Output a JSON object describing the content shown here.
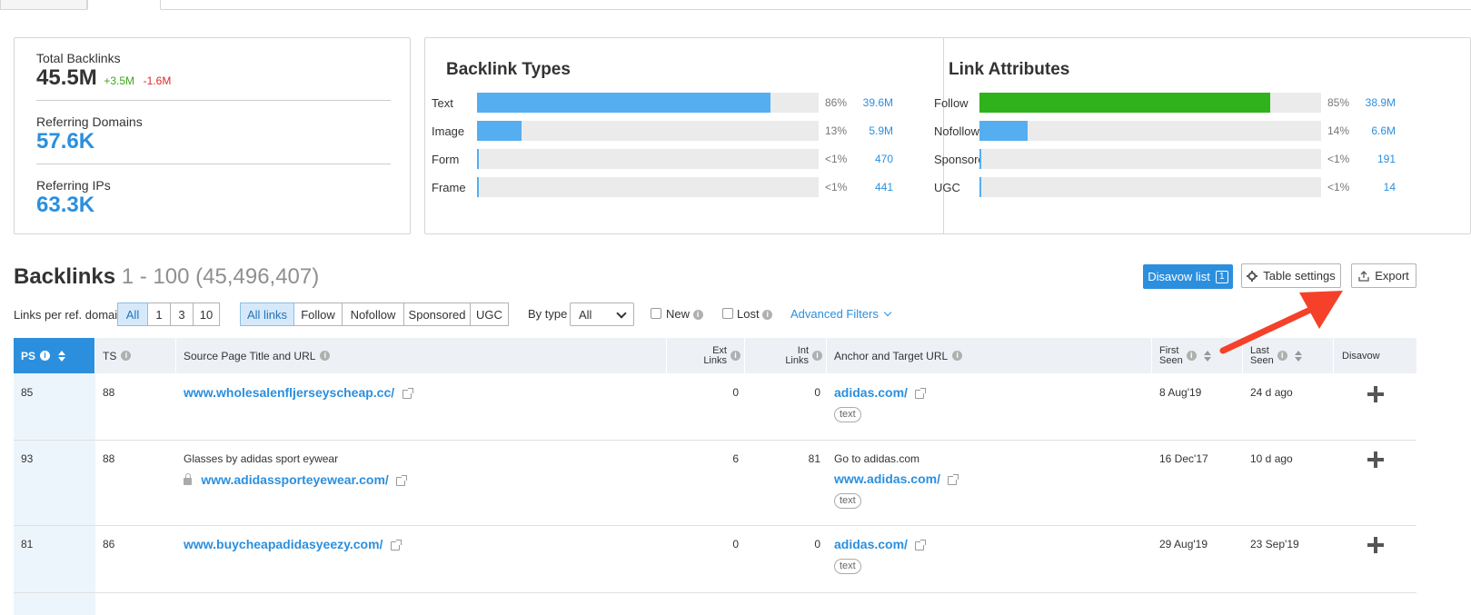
{
  "summary": {
    "total_backlinks_label": "Total Backlinks",
    "total_backlinks_value": "45.5M",
    "total_backlinks_up": "+3.5M",
    "total_backlinks_down": "-1.6M",
    "referring_domains_label": "Referring Domains",
    "referring_domains_value": "57.6K",
    "referring_ips_label": "Referring IPs",
    "referring_ips_value": "63.3K"
  },
  "backlink_types": {
    "title": "Backlink Types",
    "rows": [
      {
        "label": "Text",
        "pct": "86%",
        "count": "39.6M",
        "fill": 0.86,
        "color": "#55aef0"
      },
      {
        "label": "Image",
        "pct": "13%",
        "count": "5.9M",
        "fill": 0.13,
        "color": "#55aef0"
      },
      {
        "label": "Form",
        "pct": "<1%",
        "count": "470",
        "fill": 0.005,
        "color": "#55aef0"
      },
      {
        "label": "Frame",
        "pct": "<1%",
        "count": "441",
        "fill": 0.005,
        "color": "#55aef0"
      }
    ]
  },
  "link_attributes": {
    "title": "Link Attributes",
    "rows": [
      {
        "label": "Follow",
        "pct": "85%",
        "count": "38.9M",
        "fill": 0.85,
        "color": "#2fb21b"
      },
      {
        "label": "Nofollow",
        "pct": "14%",
        "count": "6.6M",
        "fill": 0.14,
        "color": "#55aef0"
      },
      {
        "label": "Sponsored",
        "pct": "<1%",
        "count": "191",
        "fill": 0.005,
        "color": "#55aef0"
      },
      {
        "label": "UGC",
        "pct": "<1%",
        "count": "14",
        "fill": 0.005,
        "color": "#55aef0"
      }
    ]
  },
  "backlinks": {
    "title": "Backlinks",
    "range": "1 - 100 (45,496,407)",
    "disavow_label": "Disavow list",
    "disavow_count": "1",
    "table_settings_label": "Table settings",
    "export_label": "Export"
  },
  "filters": {
    "links_per_domain_label": "Links per ref. domain",
    "links_per_domain_options": [
      "All",
      "1",
      "3",
      "10"
    ],
    "link_type_options": [
      "All links",
      "Follow",
      "Nofollow",
      "Sponsored",
      "UGC"
    ],
    "by_type_label": "By type",
    "by_type_value": "All",
    "new_label": "New",
    "lost_label": "Lost",
    "advanced_label": "Advanced Filters"
  },
  "table": {
    "headers": {
      "ps": "PS",
      "ts": "TS",
      "source": "Source Page Title and URL",
      "ext_1": "Ext",
      "ext_2": "Links",
      "int_1": "Int",
      "int_2": "Links",
      "anchor": "Anchor and Target URL",
      "first_1": "First",
      "first_2": "Seen",
      "last_1": "Last",
      "last_2": "Seen",
      "disavow": "Disavow"
    },
    "rows": [
      {
        "ps": "85",
        "ts": "88",
        "title": "",
        "url": "www.wholesalenfljerseyscheap.cc/",
        "ext": "0",
        "int": "0",
        "anchor_text": "",
        "target": "adidas.com/",
        "type": "text",
        "first": "8 Aug'19",
        "last": "24 d ago"
      },
      {
        "ps": "93",
        "ts": "88",
        "title": "Glasses by adidas sport eywear",
        "url": "www.adidassporteyewear.com/",
        "ext": "6",
        "int": "81",
        "anchor_text": "Go to adidas.com",
        "target": "www.adidas.com/",
        "type": "text",
        "first": "16 Dec'17",
        "last": "10 d ago"
      },
      {
        "ps": "81",
        "ts": "86",
        "title": "",
        "url": "www.buycheapadidasyeezy.com/",
        "ext": "0",
        "int": "0",
        "anchor_text": "",
        "target": "adidas.com/",
        "type": "text",
        "first": "29 Aug'19",
        "last": "23 Sep'19"
      }
    ]
  },
  "colors": {
    "accent": "#2b8fde",
    "follow": "#2fb21b",
    "positive": "#3aa81b",
    "negative": "#e0262a",
    "annotation_arrow": "#f5412a"
  },
  "icons": {
    "info": "info-icon",
    "gear": "gear-icon",
    "export": "export-icon",
    "external": "external-link-icon",
    "lock": "lock-icon",
    "plus": "plus-icon",
    "sort": "sort-icon"
  }
}
